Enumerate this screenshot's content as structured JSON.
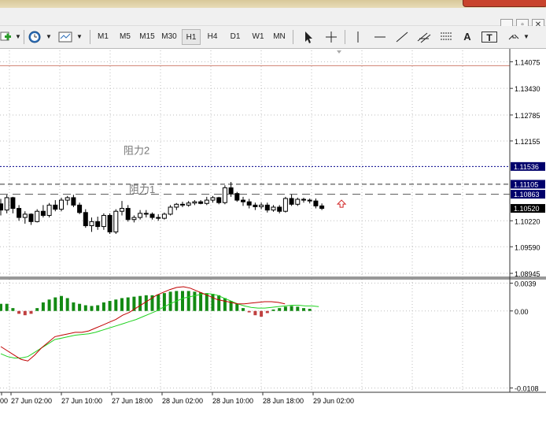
{
  "toolbar": {
    "timeframes": [
      {
        "label": "M1",
        "selected": false
      },
      {
        "label": "M5",
        "selected": false
      },
      {
        "label": "M15",
        "selected": false
      },
      {
        "label": "M30",
        "selected": false
      },
      {
        "label": "H1",
        "selected": true
      },
      {
        "label": "H4",
        "selected": false
      },
      {
        "label": "D1",
        "selected": false
      },
      {
        "label": "W1",
        "selected": false
      },
      {
        "label": "MN",
        "selected": false
      }
    ],
    "text_tool_label": "A",
    "text_label_tool_label": "T"
  },
  "window_controls": {
    "minimize": "_",
    "restore": "▫",
    "close": "✕"
  },
  "price_axis": {
    "ticks": [
      "1.14075",
      "1.13430",
      "1.12785",
      "1.12155",
      "1.11536",
      "1.11105",
      "1.10863",
      "1.10520",
      "1.10220",
      "1.09590",
      "1.08945"
    ],
    "tags": {
      "s2": "1.11536",
      "s1": "1.11105",
      "level": "1.10863",
      "current": "1.10520"
    }
  },
  "drawings": {
    "resistance2": "阻力2",
    "resistance1": "阻力1"
  },
  "indicator_axis": {
    "ticks": [
      "0.0039",
      "0.00",
      "-0.0108"
    ]
  },
  "time_axis": {
    "labels": [
      "00",
      "27 Jun 02:00",
      "27 Jun 10:00",
      "27 Jun 18:00",
      "28 Jun 02:00",
      "28 Jun 10:00",
      "28 Jun 18:00",
      "29 Jun 02:00"
    ]
  },
  "chart_data": {
    "type": "candlestick",
    "symbol_timeframe": "H1",
    "price_range": [
      1.0885,
      1.1435
    ],
    "horizontal_levels": [
      1.1398,
      1.11536,
      1.11105,
      1.10863
    ],
    "candles": [
      [
        1.1063,
        1.1075,
        1.1035,
        1.1048
      ],
      [
        1.1048,
        1.1085,
        1.104,
        1.1078
      ],
      [
        1.1078,
        1.108,
        1.104,
        1.1052
      ],
      [
        1.1052,
        1.106,
        1.1022,
        1.103
      ],
      [
        1.103,
        1.1045,
        1.1015,
        1.1038
      ],
      [
        1.1038,
        1.104,
        1.1012,
        1.102
      ],
      [
        1.102,
        1.105,
        1.1018,
        1.1045
      ],
      [
        1.1045,
        1.106,
        1.103,
        1.1035
      ],
      [
        1.1035,
        1.1065,
        1.103,
        1.106
      ],
      [
        1.106,
        1.1072,
        1.1045,
        1.105
      ],
      [
        1.105,
        1.1078,
        1.1045,
        1.1072
      ],
      [
        1.1072,
        1.1082,
        1.106,
        1.1078
      ],
      [
        1.1078,
        1.1085,
        1.1055,
        1.106
      ],
      [
        1.106,
        1.1066,
        1.1038,
        1.1042
      ],
      [
        1.1042,
        1.105,
        1.1005,
        1.101
      ],
      [
        1.101,
        1.103,
        1.0995,
        1.102
      ],
      [
        1.102,
        1.1032,
        1.1,
        1.1008
      ],
      [
        1.1008,
        1.104,
        1.1,
        1.1035
      ],
      [
        1.1035,
        1.104,
        1.099,
        1.0995
      ],
      [
        1.0995,
        1.105,
        1.099,
        1.1045
      ],
      [
        1.1045,
        1.107,
        1.1035,
        1.1052
      ],
      [
        1.1052,
        1.106,
        1.102,
        1.1025
      ],
      [
        1.1025,
        1.1035,
        1.1018,
        1.103
      ],
      [
        1.103,
        1.1048,
        1.1025,
        1.104
      ],
      [
        1.104,
        1.1048,
        1.103,
        1.1038
      ],
      [
        1.1038,
        1.1042,
        1.1025,
        1.103
      ],
      [
        1.103,
        1.1038,
        1.1022,
        1.1028
      ],
      [
        1.1028,
        1.1042,
        1.1025,
        1.1038
      ],
      [
        1.1038,
        1.106,
        1.1035,
        1.1055
      ],
      [
        1.1055,
        1.1065,
        1.1048,
        1.1062
      ],
      [
        1.1062,
        1.1068,
        1.1055,
        1.106
      ],
      [
        1.106,
        1.107,
        1.1056,
        1.1065
      ],
      [
        1.1065,
        1.1072,
        1.106,
        1.1068
      ],
      [
        1.1068,
        1.1072,
        1.1062,
        1.1064
      ],
      [
        1.1064,
        1.108,
        1.106,
        1.1072
      ],
      [
        1.1072,
        1.1082,
        1.1066,
        1.1078
      ],
      [
        1.1078,
        1.108,
        1.1062,
        1.1066
      ],
      [
        1.1066,
        1.1108,
        1.1062,
        1.1102
      ],
      [
        1.1102,
        1.1116,
        1.108,
        1.1088
      ],
      [
        1.1088,
        1.1092,
        1.1068,
        1.1072
      ],
      [
        1.1072,
        1.108,
        1.1058,
        1.1068
      ],
      [
        1.1068,
        1.1075,
        1.1052,
        1.106
      ],
      [
        1.106,
        1.1066,
        1.1048,
        1.1056
      ],
      [
        1.1056,
        1.1066,
        1.105,
        1.106
      ],
      [
        1.106,
        1.1066,
        1.1042,
        1.1048
      ],
      [
        1.1048,
        1.106,
        1.1044,
        1.1055
      ],
      [
        1.1055,
        1.106,
        1.104,
        1.1045
      ],
      [
        1.1045,
        1.108,
        1.1042,
        1.1076
      ],
      [
        1.1076,
        1.1086,
        1.1058,
        1.1062
      ],
      [
        1.1062,
        1.1078,
        1.1058,
        1.1074
      ],
      [
        1.1074,
        1.1078,
        1.1066,
        1.1072
      ],
      [
        1.1072,
        1.1076,
        1.1064,
        1.107
      ],
      [
        1.107,
        1.1076,
        1.1052,
        1.1058
      ],
      [
        1.1058,
        1.1064,
        1.1048,
        1.1052
      ]
    ],
    "macd_histogram": [
      0.001,
      0.001,
      0.0004,
      -0.0004,
      -0.0006,
      -0.0004,
      0.0004,
      0.0012,
      0.0016,
      0.0019,
      0.0021,
      0.0018,
      0.0012,
      0.001,
      0.0008,
      0.0007,
      0.0008,
      0.0012,
      0.0014,
      0.0016,
      0.0018,
      0.0019,
      0.002,
      0.0021,
      0.0022,
      0.0022,
      0.0023,
      0.0025,
      0.0027,
      0.0028,
      0.0028,
      0.0028,
      0.0027,
      0.0026,
      0.0025,
      0.0024,
      0.0022,
      0.0018,
      0.0014,
      0.001,
      0.0004,
      -0.0002,
      -0.0006,
      -0.0008,
      -0.0003,
      0.0002,
      0.0004,
      0.0006,
      0.0007,
      0.0006,
      0.0004,
      0.0003
    ],
    "signal_line": [
      -0.006,
      -0.0064,
      -0.0066,
      -0.0066,
      -0.0064,
      -0.0058,
      -0.0052,
      -0.0046,
      -0.004,
      -0.0038,
      -0.0036,
      -0.0034,
      -0.0033,
      -0.0032,
      -0.003,
      -0.0027,
      -0.0024,
      -0.0021,
      -0.0018,
      -0.0015,
      -0.0012,
      -0.0008,
      -0.0004,
      0.0,
      0.0005,
      0.001,
      0.0014,
      0.0018,
      0.002,
      0.0022,
      0.0024,
      0.0024,
      0.0022,
      0.0018,
      0.0014,
      0.001,
      0.0007,
      0.0005,
      0.0004,
      0.0004,
      0.0005,
      0.0006,
      0.0007,
      0.0008,
      0.0008,
      0.0007,
      0.0007,
      0.0006
    ],
    "macd_line": [
      -0.005,
      -0.0056,
      -0.0062,
      -0.0068,
      -0.007,
      -0.0062,
      -0.0052,
      -0.0044,
      -0.0036,
      -0.0034,
      -0.0032,
      -0.003,
      -0.003,
      -0.0028,
      -0.0024,
      -0.002,
      -0.0016,
      -0.0012,
      -0.0006,
      -0.0002,
      0.0004,
      0.001,
      0.0016,
      0.0022,
      0.0026,
      0.003,
      0.0033,
      0.0034,
      0.0032,
      0.0028,
      0.0024,
      0.002,
      0.0016,
      0.0014,
      0.0012,
      0.001,
      0.001,
      0.0011,
      0.0012,
      0.0013,
      0.0013,
      0.0012,
      0.001
    ],
    "colors": {
      "up_candle": "#ffffff",
      "down_candle": "#000000",
      "macd_up": "#138a13",
      "macd_down": "#c04040",
      "macd_line": "#c00000",
      "signal_line": "#1fd21f",
      "resistance_line": "#00008b",
      "grid": "#bdbdbd"
    }
  }
}
